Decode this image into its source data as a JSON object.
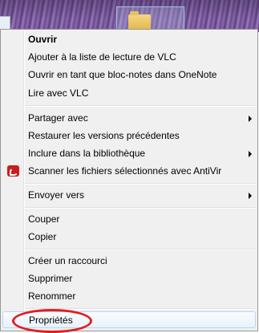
{
  "menu": {
    "items": [
      {
        "label": "Ouvrir"
      },
      {
        "label": "Ajouter à la liste de lecture de VLC"
      },
      {
        "label": "Ouvrir en tant que bloc-notes dans OneNote"
      },
      {
        "label": "Lire avec VLC"
      },
      {
        "label": "Partager avec"
      },
      {
        "label": "Restaurer les versions précédentes"
      },
      {
        "label": "Inclure dans la bibliothèque"
      },
      {
        "label": "Scanner les fichiers sélectionnés avec AntiVir"
      },
      {
        "label": "Envoyer vers"
      },
      {
        "label": "Couper"
      },
      {
        "label": "Copier"
      },
      {
        "label": "Créer un raccourci"
      },
      {
        "label": "Supprimer"
      },
      {
        "label": "Renommer"
      },
      {
        "label": "Propriétés"
      }
    ]
  },
  "annotation": {
    "highlight_color": "#e11d1d",
    "circled_item": "Propriétés"
  },
  "icons": {
    "antivir": "antivir-umbrella-icon",
    "submenu": "submenu-arrow-icon"
  }
}
